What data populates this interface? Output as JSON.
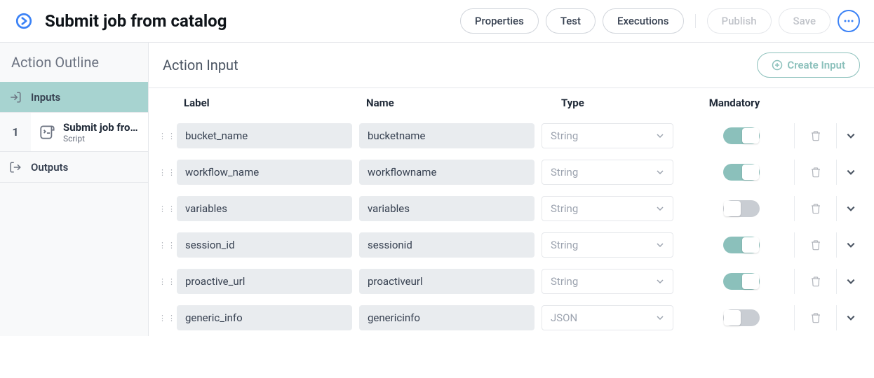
{
  "header": {
    "title": "Submit job from catalog",
    "btn_properties": "Properties",
    "btn_test": "Test",
    "btn_executions": "Executions",
    "btn_publish": "Publish",
    "btn_save": "Save"
  },
  "sidebar": {
    "title": "Action Outline",
    "inputs_label": "Inputs",
    "outputs_label": "Outputs",
    "step": {
      "index": "1",
      "title": "Submit job fro…",
      "subtitle": "Script"
    }
  },
  "main": {
    "title": "Action Input",
    "create_label": "Create Input",
    "columns": {
      "label": "Label",
      "name": "Name",
      "type": "Type",
      "mandatory": "Mandatory"
    },
    "rows": [
      {
        "label": "bucket_name",
        "name": "bucketname",
        "type": "String",
        "mandatory": true
      },
      {
        "label": "workflow_name",
        "name": "workflowname",
        "type": "String",
        "mandatory": true
      },
      {
        "label": "variables",
        "name": "variables",
        "type": "String",
        "mandatory": false
      },
      {
        "label": "session_id",
        "name": "sessionid",
        "type": "String",
        "mandatory": true
      },
      {
        "label": "proactive_url",
        "name": "proactiveurl",
        "type": "String",
        "mandatory": true
      },
      {
        "label": "generic_info",
        "name": "genericinfo",
        "type": "JSON",
        "mandatory": false
      }
    ]
  }
}
